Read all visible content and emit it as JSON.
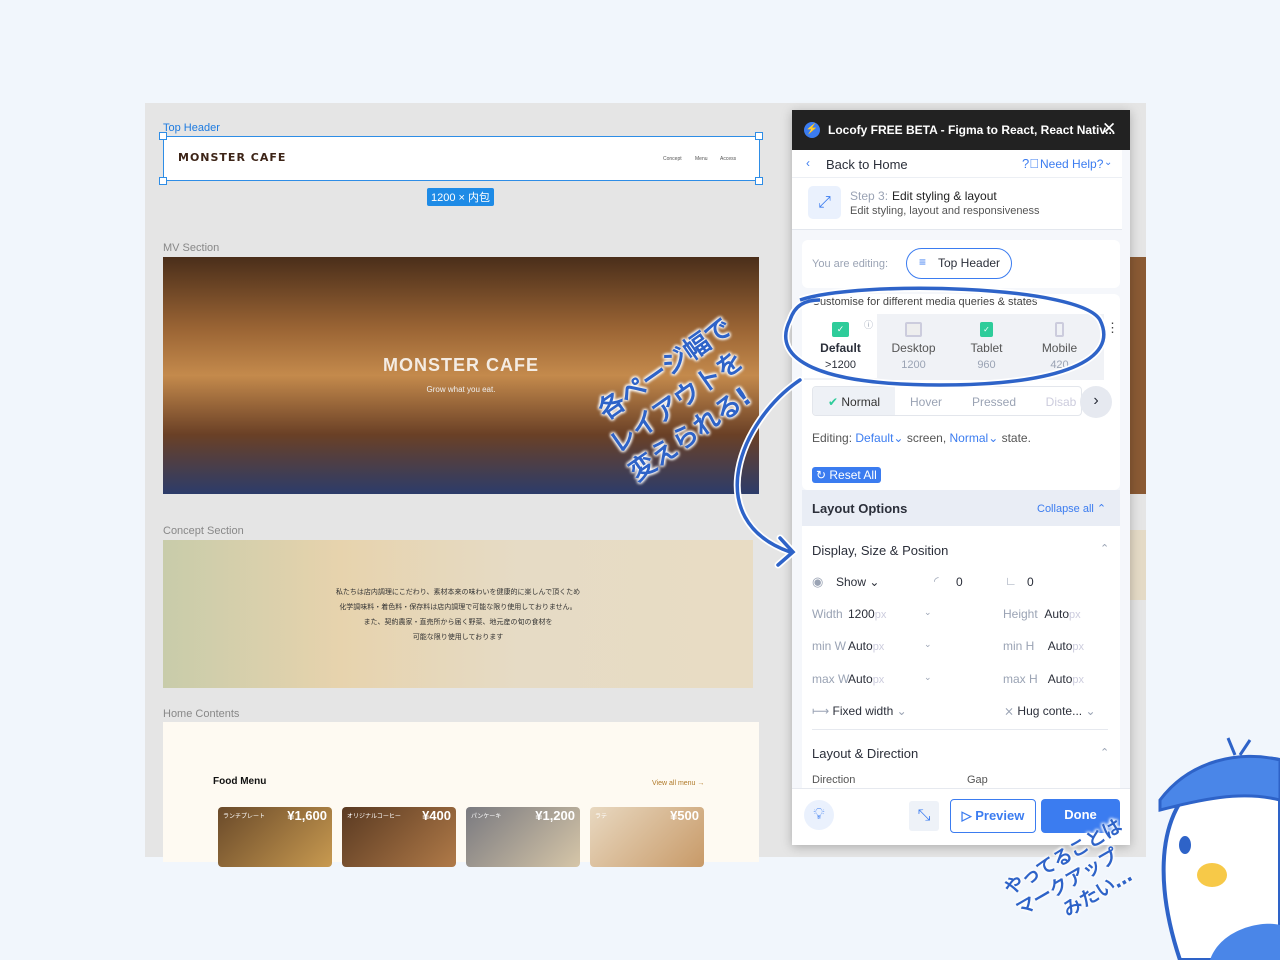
{
  "canvas": {
    "top_header_label": "Top Header",
    "size_badge": "1200 × 内包",
    "logo_text": "MONSTER CAFE",
    "nav": [
      "Concept",
      "Menu",
      "Access"
    ],
    "mv_label": "MV Section",
    "mv_title": "MONSTER CAFE",
    "mv_subtitle": "Grow what you eat.",
    "concept_label": "Concept Section",
    "concept_lines": [
      "私たちは店内調理にこだわり、素材本来の味わいを健康的に楽しんで頂くため",
      "化学調味料・着色料・保存料は店内調理で可能な限り使用しておりません。",
      "また、契約農家・直売所から届く野菜、地元産の旬の食材を",
      "可能な限り使用しております"
    ],
    "home_label": "Home Contents",
    "food_menu_title": "Food Menu",
    "view_all": "View all menu →",
    "food_cards": [
      {
        "name": "ランチプレート",
        "price": "¥1,600"
      },
      {
        "name": "オリジナルコーヒー",
        "price": "¥400"
      },
      {
        "name": "パンケーキ",
        "price": "¥1,200"
      },
      {
        "name": "ラテ",
        "price": "¥500"
      }
    ]
  },
  "panel": {
    "title": "Locofy FREE BETA - Figma to React, React Nativ...",
    "back": "Back to Home",
    "help": "Need Help?",
    "step_prefix": "Step 3:",
    "step_title": "Edit styling & layout",
    "step_sub": "Edit styling, layout and responsiveness",
    "editing_label": "You are editing:",
    "editing_target": "Top Header",
    "media_caption": "Customise for different media queries & states",
    "media_tabs": [
      {
        "label": "Default",
        "value": ">1200",
        "checked": true,
        "active": true
      },
      {
        "label": "Desktop",
        "value": "1200",
        "checked": false
      },
      {
        "label": "Tablet",
        "value": "960",
        "checked": true
      },
      {
        "label": "Mobile",
        "value": "420",
        "checked": false
      }
    ],
    "states": [
      "Normal",
      "Hover",
      "Pressed",
      "Disab"
    ],
    "editing_line": {
      "prefix": "Editing:",
      "screen": "Default",
      "mid": "screen,",
      "state": "Normal",
      "suffix": "state."
    },
    "reset_all": "Reset All",
    "layout_options": "Layout Options",
    "collapse_all": "Collapse all",
    "display_section": "Display, Size & Position",
    "show": "Show",
    "radius": "0",
    "corner": "0",
    "fields": {
      "width": {
        "label": "Width",
        "value": "1200",
        "unit": "px"
      },
      "height": {
        "label": "Height",
        "value": "Auto",
        "unit": "px"
      },
      "min_w": {
        "label": "min W",
        "value": "Auto",
        "unit": "px"
      },
      "min_h": {
        "label": "min H",
        "value": "Auto",
        "unit": "px"
      },
      "max_w": {
        "label": "max W",
        "value": "Auto",
        "unit": "px"
      },
      "max_h": {
        "label": "max H",
        "value": "Auto",
        "unit": "px"
      }
    },
    "fixed_width": "Fixed width",
    "hug_content": "Hug conte...",
    "layout_direction": "Layout & Direction",
    "direction": "Direction",
    "gap": "Gap",
    "preview": "Preview",
    "done": "Done"
  },
  "annotations": {
    "note1": [
      "各ページ幅で",
      "レイアウトを",
      "変えられる!"
    ],
    "note2": [
      "やってることは",
      "マークアップ",
      "みたい…"
    ]
  },
  "colors": {
    "accent": "#3b7cf0",
    "selection": "#2e8de6",
    "annotation": "#2e63c8",
    "check": "#2ecc9a"
  }
}
